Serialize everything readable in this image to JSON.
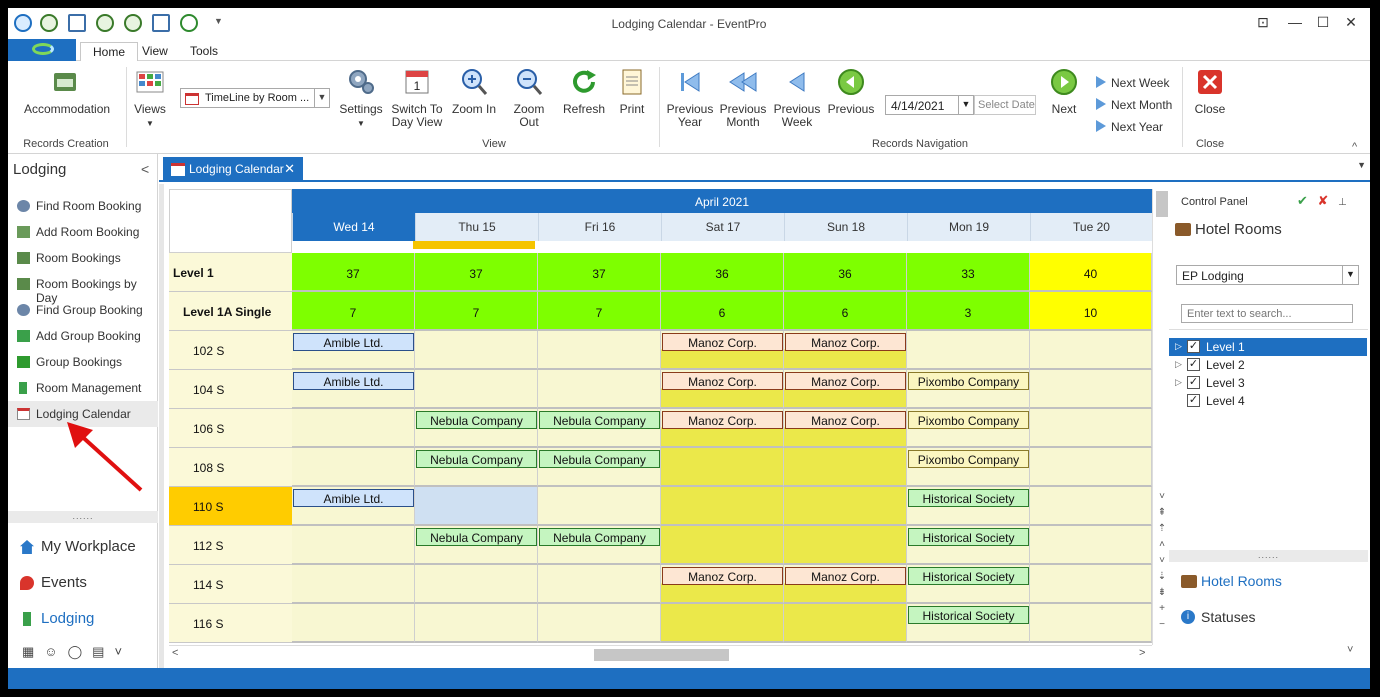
{
  "window": {
    "title": "Lodging Calendar - EventPro",
    "controls": [
      "⊡",
      "—",
      "☐",
      "✕"
    ]
  },
  "menu": {
    "tabs": [
      "Home",
      "View",
      "Tools"
    ]
  },
  "ribbon": {
    "accommodation": "Accommodation",
    "records_creation": "Records Creation",
    "views": "Views",
    "views_combo": "TimeLine by Room ...",
    "settings": "Settings",
    "switch_to_day_view": "Switch To Day View",
    "zoom_in": "Zoom In",
    "zoom_out": "Zoom Out",
    "refresh": "Refresh",
    "print": "Print",
    "view_group": "View",
    "previous_year": "Previous Year",
    "previous_month": "Previous Month",
    "previous_week": "Previous Week",
    "previous": "Previous",
    "date_value": "4/14/2021",
    "select_date": "Select Date",
    "next": "Next",
    "next_week": "Next Week",
    "next_month": "Next Month",
    "next_year": "Next Year",
    "records_navigation": "Records Navigation",
    "close": "Close",
    "close_group": "Close",
    "day_icon_number": "1"
  },
  "sidebar": {
    "title": "Lodging",
    "items": [
      "Find Room Booking",
      "Add Room Booking",
      "Room Bookings",
      "Room Bookings by Day",
      "Find Group Booking",
      "Add Group Booking",
      "Group Bookings",
      "Room Management",
      "Lodging Calendar"
    ],
    "modules": [
      "My Workplace",
      "Events",
      "Lodging"
    ]
  },
  "doc_tab": {
    "label": "Lodging Calendar"
  },
  "calendar": {
    "month": "April 2021",
    "days": [
      "Wed 14",
      "Thu 15",
      "Fri 16",
      "Sat 17",
      "Sun 18",
      "Mon 19",
      "Tue 20"
    ],
    "level1": {
      "label": "Level 1",
      "counts": [
        "37",
        "37",
        "37",
        "36",
        "36",
        "33",
        "40"
      ]
    },
    "level1a": {
      "label": "Level 1A Single",
      "counts": [
        "7",
        "7",
        "7",
        "6",
        "6",
        "3",
        "10"
      ]
    },
    "rooms": [
      "102 S",
      "104 S",
      "106 S",
      "108 S",
      "110 S",
      "112 S",
      "114 S",
      "116 S"
    ],
    "booking_names": {
      "amible": "Amible Ltd.",
      "manoz": "Manoz Corp.",
      "nebula": "Nebula Company",
      "pixombo": "Pixombo Company",
      "historical": "Historical Society"
    },
    "colors": {
      "green": "#7eff00",
      "yellow": "#ffff00",
      "weekend": "#ebe84a",
      "cell": "#f8f7d2",
      "highlight_room": "#ffcc00"
    }
  },
  "control_panel": {
    "title": "Control Panel",
    "heading": "Hotel Rooms",
    "combo": "EP Lodging",
    "search_placeholder": "Enter text to search...",
    "levels": [
      "Level 1",
      "Level 2",
      "Level 3",
      "Level 4"
    ],
    "hotel_rooms": "Hotel Rooms",
    "statuses": "Statuses"
  }
}
